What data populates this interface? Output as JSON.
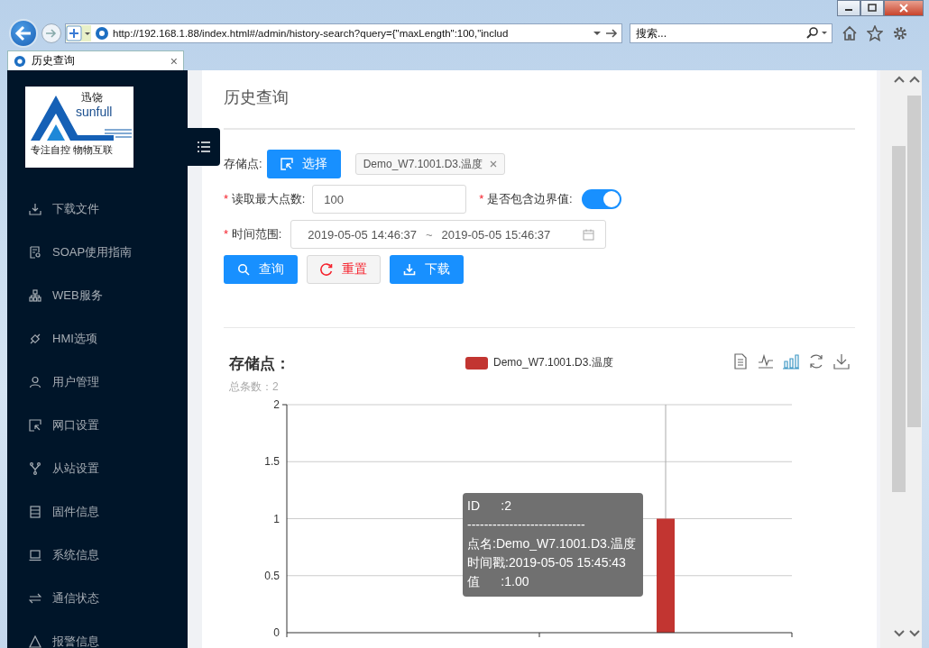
{
  "browser": {
    "url": "http://192.168.1.88/index.html#/admin/history-search?query={\"maxLength\":100,\"includ",
    "search_placeholder": "搜索...",
    "tab": {
      "title": "历史查询",
      "close": "×"
    }
  },
  "sidebar": {
    "logo": {
      "brand_cn": "迅饶",
      "brand_en": "sunfull",
      "slogan": "专注自控 物物互联"
    },
    "items": [
      {
        "label": "下载文件"
      },
      {
        "label": "SOAP使用指南"
      },
      {
        "label": "WEB服务"
      },
      {
        "label": "HMI选项"
      },
      {
        "label": "用户管理"
      },
      {
        "label": "网口设置"
      },
      {
        "label": "从站设置"
      },
      {
        "label": "固件信息"
      },
      {
        "label": "系统信息"
      },
      {
        "label": "通信状态"
      },
      {
        "label": "报警信息"
      }
    ]
  },
  "page": {
    "title": "历史查询",
    "form": {
      "storage_point": {
        "label": "存储点:",
        "button": "选择",
        "tag": "Demo_W7.1001.D3.温度"
      },
      "max_points": {
        "required_mark": "*",
        "label": "读取最大点数:",
        "value": "100"
      },
      "include_boundary": {
        "required_mark": "*",
        "label": "是否包含边界值:",
        "on": true
      },
      "time_range": {
        "required_mark": "*",
        "label": "时间范围:",
        "start": "2019-05-05 14:46:37",
        "separator": "~",
        "end": "2019-05-05 15:46:37"
      },
      "buttons": [
        {
          "label": "查询",
          "kind": "primary"
        },
        {
          "label": "重置",
          "kind": "default"
        },
        {
          "label": "下载",
          "kind": "primary"
        }
      ]
    },
    "chart": {
      "title": "存储点：",
      "subtitle": "总条数：2",
      "toolbox": [
        {
          "selected": false
        },
        {
          "selected": false
        },
        {
          "selected": true
        },
        {
          "selected": false
        },
        {
          "selected": false
        }
      ],
      "chart_data": {
        "type": "bar",
        "series": [
          {
            "name": "Demo_W7.1001.D3.温度",
            "color": "#c23531",
            "values": [
              0,
              1
            ]
          }
        ],
        "ylim": [
          0,
          2
        ],
        "yticks": [
          0,
          0.5,
          1,
          1.5,
          2
        ],
        "grid": true
      },
      "tooltip": [
        "ID      :2",
        "----------------------------",
        "点名:Demo_W7.1001.D3.温度",
        "时间戳:2019-05-05 15:45:43",
        "值      :1.00"
      ]
    }
  }
}
